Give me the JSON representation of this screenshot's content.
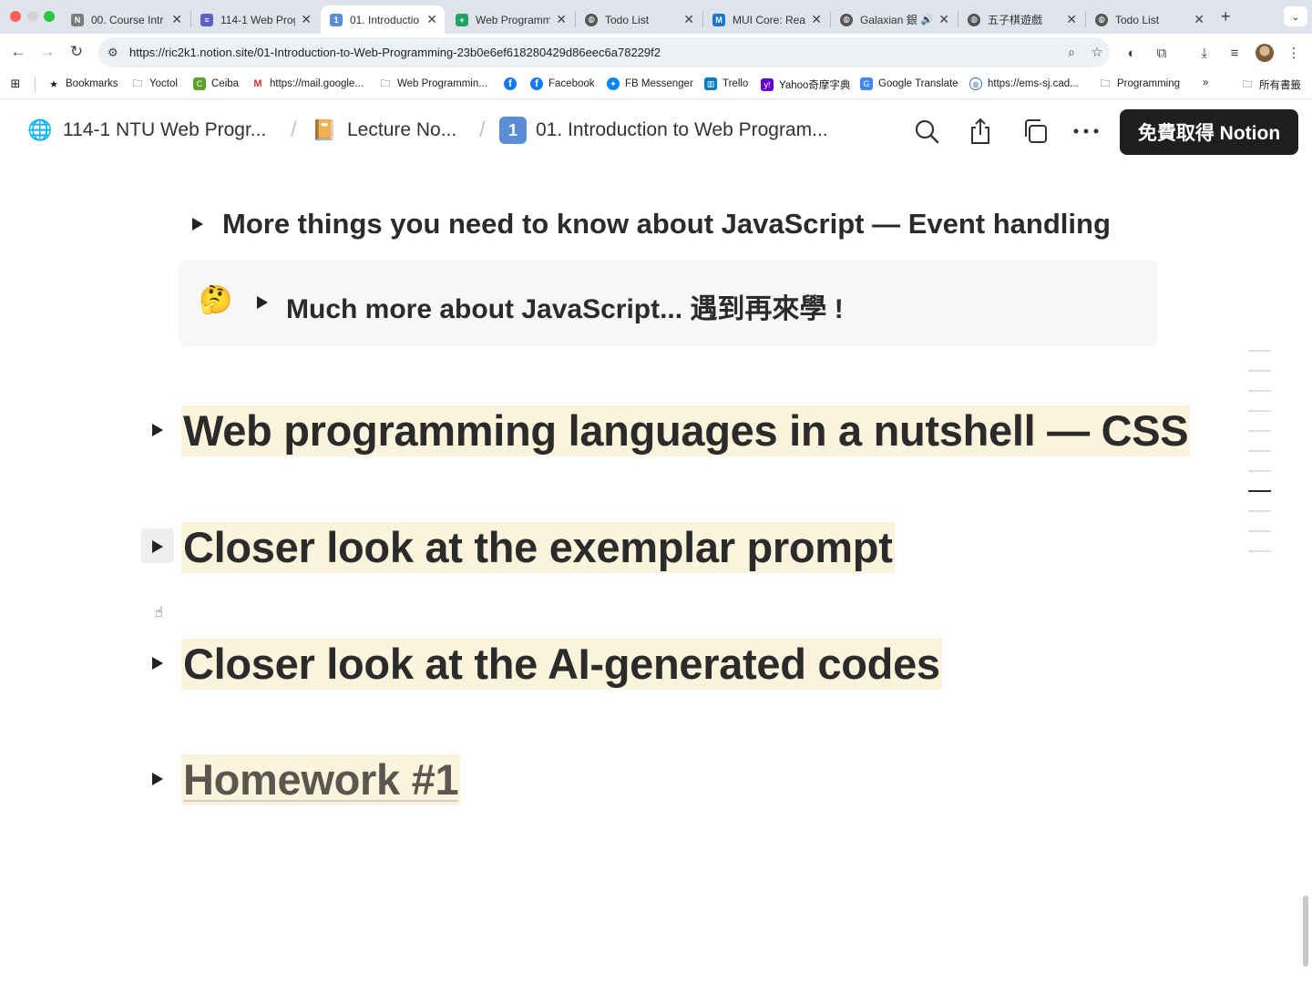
{
  "browser": {
    "tabs": [
      {
        "label": "00. Course Intr",
        "icon": "notion-icon",
        "color": "#7b7b7b"
      },
      {
        "label": "114-1 Web Prog",
        "icon": "notion-list-icon",
        "color": "#5b5fc7"
      },
      {
        "label": "01. Introductio",
        "icon": "keycap-one-icon",
        "color": "#5a8dd6",
        "active": true
      },
      {
        "label": "Web Programm",
        "icon": "sheets-icon",
        "color": "#1fa463"
      },
      {
        "label": "Todo List",
        "icon": "globe-icon",
        "color": "#555555"
      },
      {
        "label": "MUI Core: Rea",
        "icon": "mui-icon",
        "color": "#1976d2"
      },
      {
        "label": "Galaxian 銀",
        "icon": "globe-icon",
        "color": "#555555"
      },
      {
        "label": "五子棋遊戲",
        "icon": "globe-icon",
        "color": "#555555"
      },
      {
        "label": "Todo List",
        "icon": "globe-icon",
        "color": "#555555"
      }
    ],
    "url": "https://ric2k1.notion.site/01-Introduction-to-Web-Programming-23b0e6ef618280429d86eec6a78229f2",
    "bookmarks": [
      {
        "label": "Bookmarks",
        "icon": "star-icon"
      },
      {
        "label": "Yoctol",
        "icon": "folder-icon"
      },
      {
        "label": "Ceiba",
        "icon": "ceiba-icon"
      },
      {
        "label": "https://mail.google...",
        "icon": "gmail-icon"
      },
      {
        "label": "Web Programmin...",
        "icon": "folder-icon"
      },
      {
        "label": "",
        "icon": "facebook-icon"
      },
      {
        "label": "Facebook",
        "icon": "facebook-icon"
      },
      {
        "label": "FB Messenger",
        "icon": "messenger-icon"
      },
      {
        "label": "Trello",
        "icon": "trello-icon"
      },
      {
        "label": "Yahoo奇摩字典",
        "icon": "yahoo-icon"
      },
      {
        "label": "Google Translate",
        "icon": "translate-icon"
      },
      {
        "label": "https://ems-sj.cad...",
        "icon": "globe-icon"
      },
      {
        "label": "Programming",
        "icon": "folder-icon"
      },
      {
        "label": "»",
        "icon": "more-bookmarks-icon"
      },
      {
        "label": "所有書籤",
        "icon": "folder-icon"
      }
    ]
  },
  "notion": {
    "breadcrumbs": [
      {
        "label": "114-1 NTU Web Progr...",
        "icon": "globe-icon"
      },
      {
        "label": "Lecture No...",
        "icon": "notebook-icon"
      },
      {
        "label": "01. Introduction to Web Program...",
        "icon": "keycap-one-icon"
      }
    ],
    "cta_label": "免費取得 Notion"
  },
  "content": {
    "toggle_js_events": "More things you need to know about JavaScript — Event handling",
    "callout_emoji": "🤔",
    "callout_toggle": "Much more about JavaScript... 遇到再來學 !",
    "headings": [
      {
        "text": "Web programming languages in a nutshell — CSS"
      },
      {
        "text": "Closer look at the exemplar prompt"
      },
      {
        "text": "Closer look at the AI-generated codes"
      },
      {
        "text": "Homework #1"
      }
    ]
  },
  "colors": {
    "heading_highlight": "#fbf3db",
    "cta_background": "#1f1f1f",
    "callout_background": "#f7f7f5"
  }
}
